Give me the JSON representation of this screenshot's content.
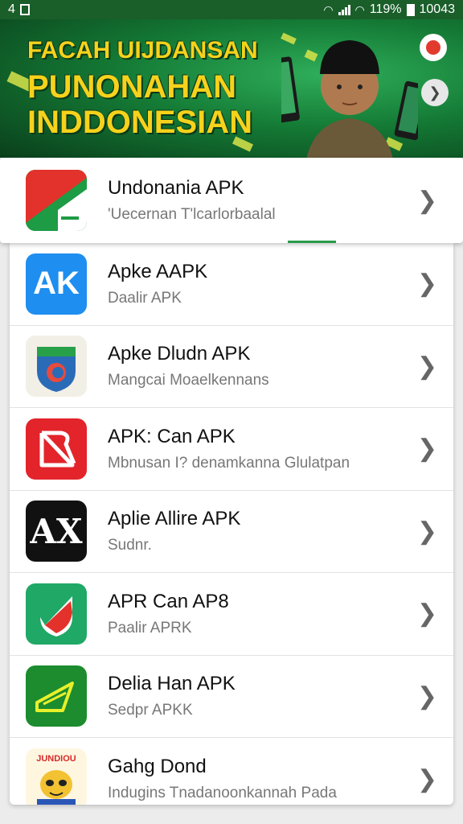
{
  "status_bar": {
    "left_text": "4",
    "battery_text": "119%",
    "time": "10043"
  },
  "banner": {
    "line1": "FACAH UIJDANSAN",
    "line2": "PUNONAHAN",
    "line3": "INDDONESIAN",
    "colors": {
      "title": "#f6d21c",
      "bg": "#147a35"
    }
  },
  "featured": {
    "title": "Undonania APK",
    "subtitle": "'Uecernan T'lcarlorbaalal",
    "icon": "green-red-flag-icon"
  },
  "apps": [
    {
      "title": "Apke AAPK",
      "subtitle": "Daalir APK",
      "icon": "ak-icon",
      "icon_text": "AK"
    },
    {
      "title": "Apke Dludn APK",
      "subtitle": "Mangcai Moaelkennans",
      "icon": "shield-emblem-icon"
    },
    {
      "title": "APK: Can APK",
      "subtitle": "Mbnusan I? denamkanna Glulatpan",
      "icon": "red-arrow-icon"
    },
    {
      "title": "Aplie Allire APK",
      "subtitle": "Sudnr.",
      "icon": "ax-icon",
      "icon_text": "AX"
    },
    {
      "title": "APR Can AP8",
      "subtitle": "Paalir APRK",
      "icon": "green-shield-icon"
    },
    {
      "title": "Delia Han APK",
      "subtitle": "Sedpr APKK",
      "icon": "green-pennant-icon"
    },
    {
      "title": "Gahg Dond",
      "subtitle": "Indugins Tnadanoonkannah Pada",
      "icon": "mascot-icon",
      "icon_text": "JUNDIOU"
    }
  ]
}
